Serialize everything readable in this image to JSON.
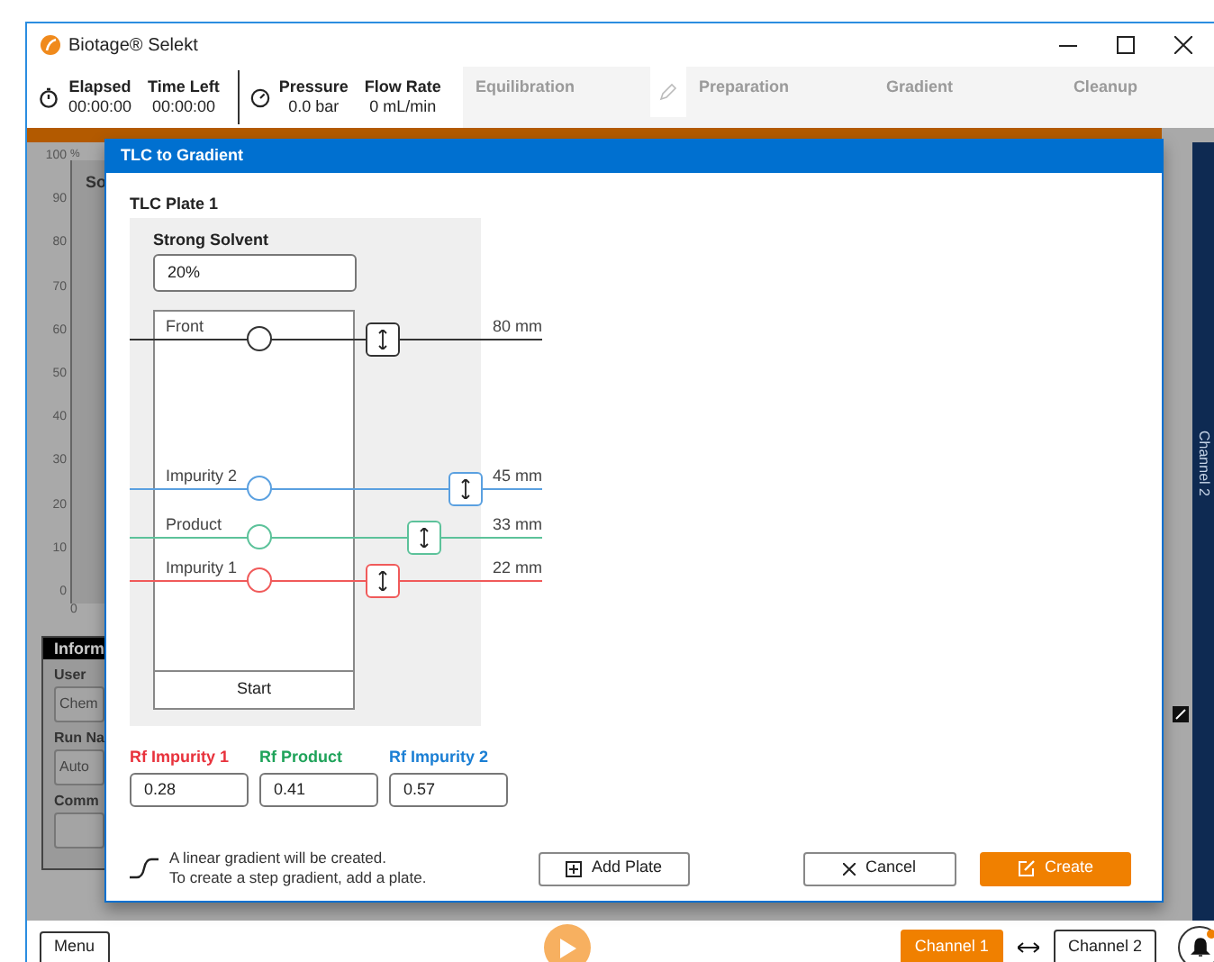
{
  "window": {
    "title": "Biotage® Selekt"
  },
  "toolbar": {
    "timers": [
      {
        "label": "Elapsed",
        "value": "00:00:00"
      },
      {
        "label": "Time Left",
        "value": "00:00:00"
      }
    ],
    "gauges": [
      {
        "label": "Pressure",
        "value": "0.0 bar"
      },
      {
        "label": "Flow Rate",
        "value": "0 mL/min"
      }
    ],
    "stages": [
      {
        "label": "Equilibration",
        "disabled": true
      },
      {
        "label": "Preparation",
        "disabled": true
      },
      {
        "label": "Gradient",
        "disabled": true
      },
      {
        "label": "Cleanup",
        "disabled": true
      }
    ]
  },
  "background": {
    "axis_unit": "%",
    "yticks": [
      "100",
      "90",
      "80",
      "70",
      "60",
      "50",
      "40",
      "30",
      "20",
      "10",
      "0"
    ],
    "xtick": "0",
    "panel_label": "So",
    "info": {
      "header": "Inform",
      "fields": [
        {
          "label": "User",
          "value": "Chem"
        },
        {
          "label": "Run Na",
          "value": "Auto"
        },
        {
          "label": "Comm"
        }
      ]
    },
    "side_tab": "Channel 2"
  },
  "dialog": {
    "title": "TLC to Gradient",
    "plate": {
      "title": "TLC Plate 1",
      "solvent_label": "Strong Solvent",
      "solvent_value": "20%",
      "start_label": "Start",
      "lines": [
        {
          "name": "Front",
          "reading": "80 mm",
          "color": "#333333"
        },
        {
          "name": "Impurity 2",
          "reading": "45 mm",
          "color": "#5aa0e0"
        },
        {
          "name": "Product",
          "reading": "33 mm",
          "color": "#5cc29a"
        },
        {
          "name": "Impurity 1",
          "reading": "22 mm",
          "color": "#f05a5a"
        }
      ]
    },
    "rf_fields": [
      {
        "label": "Rf Impurity 1",
        "value": "0.28",
        "color": "#e8323c"
      },
      {
        "label": "Rf Product",
        "value": "0.41",
        "color": "#1fa35a"
      },
      {
        "label": "Rf Impurity 2",
        "value": "0.57",
        "color": "#1b7fd4"
      }
    ],
    "note": [
      "A linear gradient will be created.",
      "To create a step gradient, add a plate."
    ],
    "buttons": {
      "add_plate": "Add Plate",
      "cancel": "Cancel",
      "create": "Create"
    }
  },
  "bottom_bar": {
    "menu": "Menu",
    "channels": [
      {
        "label": "Channel 1",
        "selected": true
      },
      {
        "label": "Channel 2",
        "selected": false
      }
    ]
  }
}
